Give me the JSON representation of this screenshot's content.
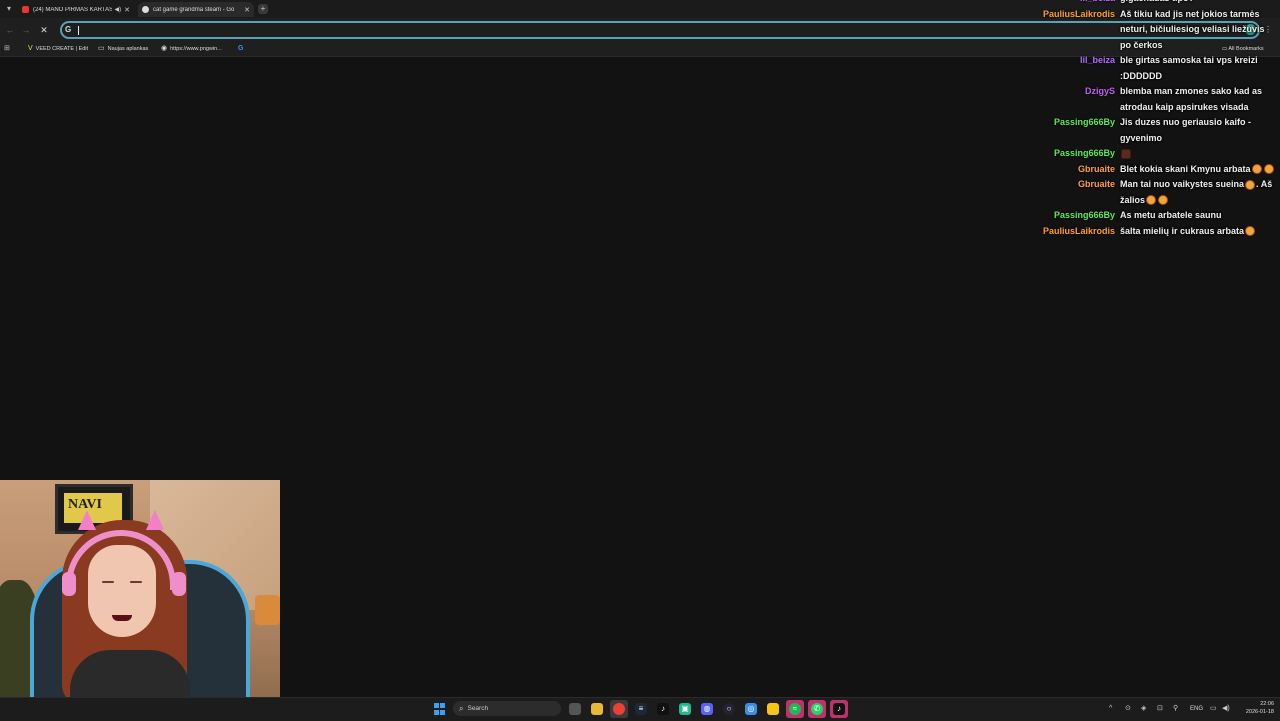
{
  "browser": {
    "tabs": [
      {
        "title": "(24) MANO PIRMAS KARTAS",
        "audio_icon": "speaker-icon",
        "favicon": "youtube-icon"
      },
      {
        "title": "cat game grandma steam - Go",
        "favicon": "google-icon"
      }
    ],
    "close_glyph": "✕",
    "new_tab_glyph": "+",
    "omnibox": {
      "value": "",
      "placeholder": "",
      "search_glyph": "G"
    },
    "account_initial": "M",
    "bookmarks": [
      {
        "label": "VEED CREATE | Edit",
        "icon": "veed-icon"
      },
      {
        "label": "Naujas aplankas",
        "icon": "folder-icon"
      },
      {
        "label": "https://www.pngwin...",
        "icon": "pngwing-icon"
      },
      {
        "label": "",
        "icon": "google-icon"
      }
    ],
    "all_bookmarks": "All Bookmarks"
  },
  "chat": {
    "messages": [
      {
        "user": "lil_beiza",
        "color": "#b267ff",
        "text": "gigachadas tipo?"
      },
      {
        "user": "PauliusLaikrodis",
        "color": "#ff9f2e",
        "text": "Aš tikiu kad jis net jokios tarmės neturi, bičiuliesiog veliasi liežuvis po čerkos"
      },
      {
        "user": "lil_beiza",
        "color": "#b267ff",
        "text": "ble girtas samoska tai vps kreizi :DDDDDD"
      },
      {
        "user": "DzigyS",
        "color": "#c25ef0",
        "text": "blemba man zmones sako kad as atrodau kaip apsirukes visada"
      },
      {
        "user": "Passing666By",
        "color": "#5ee85e",
        "text": "Jis duzes nuo geriausio kaifo - gyvenimo"
      },
      {
        "user": "Passing666By",
        "color": "#5ee85e",
        "text": "",
        "emoji_count": 1,
        "emoji_style": "dark"
      },
      {
        "user": "Gbruaite",
        "color": "#ff9f4a",
        "text": "Blet kokia skani Kmynu arbata",
        "emoji_count": 2
      },
      {
        "user": "Gbruaite",
        "color": "#ff9f4a",
        "text": "Man tai nuo vaikystes sueina",
        "emoji_count": 1,
        "tail": ". Aš žalios",
        "tail_emoji": 2
      },
      {
        "user": "Passing666By",
        "color": "#5ee85e",
        "text": "As metu arbatele saunu"
      },
      {
        "user": "PauliusLaikrodis",
        "color": "#ff9f2e",
        "text": "šalta mielių ir cukraus arbata",
        "emoji_count": 1
      }
    ]
  },
  "webcam": {
    "poster_text": "NAVI"
  },
  "taskbar": {
    "search_placeholder": "Search",
    "language": "ENG",
    "time": "22:06",
    "date": "2026-01-18"
  }
}
